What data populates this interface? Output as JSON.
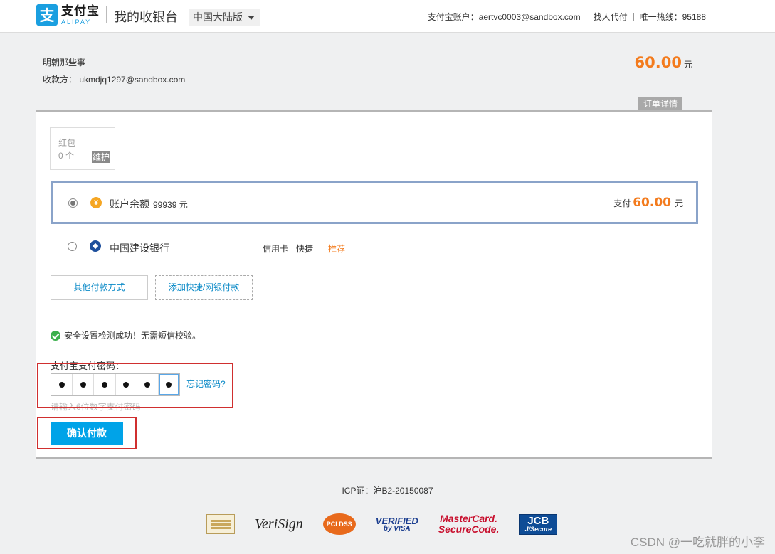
{
  "header": {
    "logo_mark": "支",
    "logo_cn": "支付宝",
    "logo_en": "ALIPAY",
    "title": "我的收银台",
    "region": "中国大陆版",
    "account_label": "支付宝账户：aertvc0003@sandbox.com",
    "proxy_pay": "找人代付",
    "hotline": "唯一热线：95188"
  },
  "order": {
    "name": "明朝那些事",
    "payee": "收款方： ukmdjq1297@sandbox.com",
    "amount": "60.00",
    "unit": "元",
    "detail_tab": "订单详情"
  },
  "coupon": {
    "title": "红包",
    "count": "0 个",
    "maintenance": "维护"
  },
  "balance": {
    "icon": "¥",
    "label": "账户余额",
    "value": "99939 元",
    "pay_prefix": "支付",
    "pay_amount": "60.00",
    "pay_unit": "元",
    "selected": true
  },
  "bank": {
    "name": "中国建设银行",
    "type1": "信用卡",
    "type2": "快捷",
    "recommend": "推荐"
  },
  "buttons": {
    "other_methods": "其他付款方式",
    "add_method": "添加快捷/网银付款",
    "confirm": "确认付款"
  },
  "security": {
    "message": "安全设置检测成功！无需短信校验。"
  },
  "password": {
    "label": "支付宝支付密码：",
    "forgot": "忘记密码?",
    "hint": "请输入6位数字支付密码",
    "filled_digits": 6
  },
  "footer": {
    "icp": "ICP证：沪B2-20150087",
    "verisign": "VeriSign",
    "pci": "PCI DSS",
    "visa_line1": "VERIFIED",
    "visa_line2": "by VISA",
    "mc_line1": "MasterCard.",
    "mc_line2": "SecureCode.",
    "jcb_line1": "JCB",
    "jcb_line2": "J/Secure",
    "watermark": "CSDN @一吃就胖的小李"
  },
  "colors": {
    "brand_blue": "#1a9fe0",
    "accent_orange": "#f37b1d",
    "confirm_blue": "#00a3e8",
    "link_blue": "#0b8ac7",
    "highlight_red": "#d02f2f",
    "selected_border": "#8aa3c9"
  }
}
